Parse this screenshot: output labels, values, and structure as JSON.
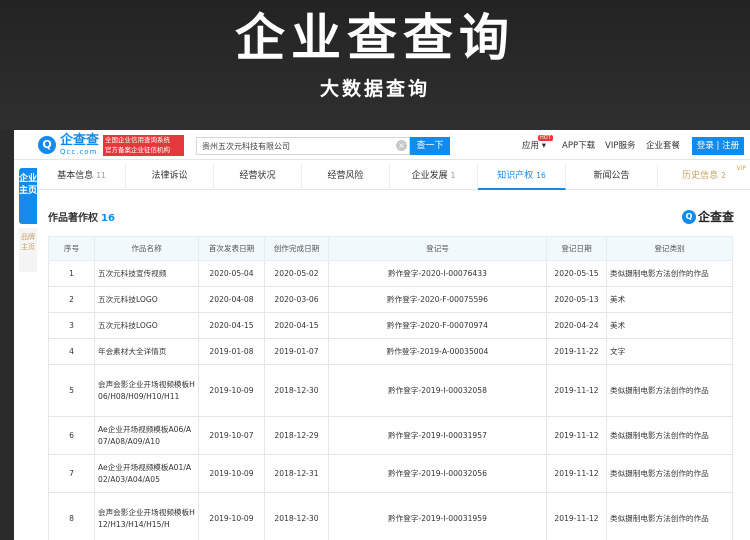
{
  "banner": {
    "title": "企业查查询",
    "subtitle": "大数据查询"
  },
  "topbar": {
    "logo_mark": "Q",
    "logo_cn": "企查查",
    "logo_en": "Qcc.com",
    "slogan_line1": "全国企业信用查询系统",
    "slogan_line2": "官方备案企业征信机构",
    "search_value": "贵州五次元科技有限公司",
    "search_button": "查一下",
    "nav": {
      "app": "应用",
      "hot_badge": "HOT",
      "app_download": "APP下载",
      "vip": "VIP服务",
      "package": "企业套餐",
      "login": "登录 | 注册"
    }
  },
  "sidebar": {
    "main_tab": "企业主页",
    "brand_tab": "品牌主页"
  },
  "tabs": [
    {
      "label": "基本信息",
      "count": "11"
    },
    {
      "label": "法律诉讼",
      "count": ""
    },
    {
      "label": "经营状况",
      "count": ""
    },
    {
      "label": "经营风险",
      "count": ""
    },
    {
      "label": "企业发展",
      "count": "1"
    },
    {
      "label": "知识产权",
      "count": "16"
    },
    {
      "label": "新闻公告",
      "count": ""
    },
    {
      "label": "历史信息",
      "count": "2",
      "badge": "VIP"
    }
  ],
  "section": {
    "title": "作品著作权",
    "count": "16",
    "brand_name": "企查查",
    "brand_mark": "Q"
  },
  "table": {
    "headers": [
      "序号",
      "作品名称",
      "首次发表日期",
      "创作完成日期",
      "登记号",
      "登记日期",
      "登记类别"
    ],
    "rows": [
      [
        "1",
        "五次元科技宣传视频",
        "2020-05-04",
        "2020-05-02",
        "黔作登字-2020-I-00076433",
        "2020-05-15",
        "类似摄制电影方法创作的作品"
      ],
      [
        "2",
        "五次元科技LOGO",
        "2020-04-08",
        "2020-03-06",
        "黔作登字-2020-F-00075596",
        "2020-05-13",
        "美术"
      ],
      [
        "3",
        "五次元科技LOGO",
        "2020-04-15",
        "2020-04-15",
        "黔作登字-2020-F-00070974",
        "2020-04-24",
        "美术"
      ],
      [
        "4",
        "年会素材大全详情页",
        "2019-01-08",
        "2019-01-07",
        "黔作登字-2019-A-00035004",
        "2019-11-22",
        "文字"
      ],
      [
        "5",
        "会声会影企业开场视频模板H06/H08/H09/H10/H11",
        "2019-10-09",
        "2018-12-30",
        "黔作登字-2019-I-00032058",
        "2019-11-12",
        "类似摄制电影方法创作的作品"
      ],
      [
        "6",
        "Ae企业开场视频模板A06/A07/A08/A09/A10",
        "2019-10-07",
        "2018-12-29",
        "黔作登字-2019-I-00031957",
        "2019-11-12",
        "类似摄制电影方法创作的作品"
      ],
      [
        "7",
        "Ae企业开场视频模板A01/A02/A03/A04/A05",
        "2019-10-09",
        "2018-12-31",
        "黔作登字-2019-I-00032056",
        "2019-11-12",
        "类似摄制电影方法创作的作品"
      ],
      [
        "8",
        "会声会影企业开场视频模板H12/H13/H14/H15/H",
        "2019-10-09",
        "2018-12-30",
        "黔作登字-2019-I-00031959",
        "2019-11-12",
        "类似摄制电影方法创作的作品"
      ]
    ]
  },
  "colors": {
    "accent": "#128bed",
    "banner_bg": "#2b2b2b",
    "slogan_bg": "#e4393c",
    "vip_gold": "#c7a366"
  }
}
